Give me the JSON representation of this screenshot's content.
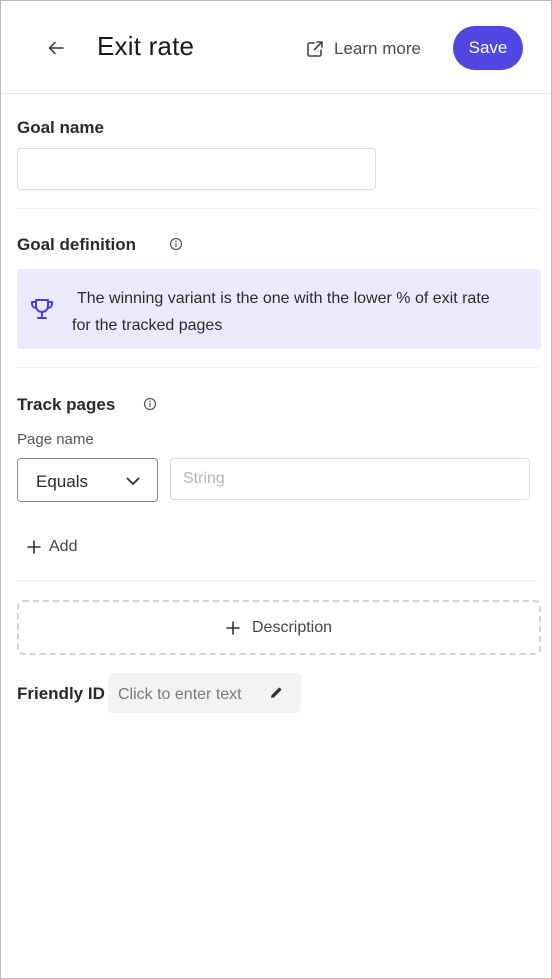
{
  "header": {
    "title": "Exit rate",
    "learn_more": "Learn more",
    "save": "Save"
  },
  "goal_name": {
    "label": "Goal name",
    "value": "",
    "placeholder": ""
  },
  "goal_definition": {
    "label": "Goal definition",
    "banner_text": "The winning variant is the one with the lower % of exit rate for the tracked pages",
    "banner_icon": "trophy-icon"
  },
  "track_pages": {
    "label": "Track pages",
    "page_name_label": "Page name",
    "operator": "Equals",
    "value_placeholder": "String",
    "add_label": "Add"
  },
  "description": {
    "label": "Description"
  },
  "friendly_id": {
    "label": "Friendly ID",
    "placeholder": "Click to enter text"
  },
  "colors": {
    "accent": "#5046e4",
    "banner_bg": "#ebeafc"
  }
}
